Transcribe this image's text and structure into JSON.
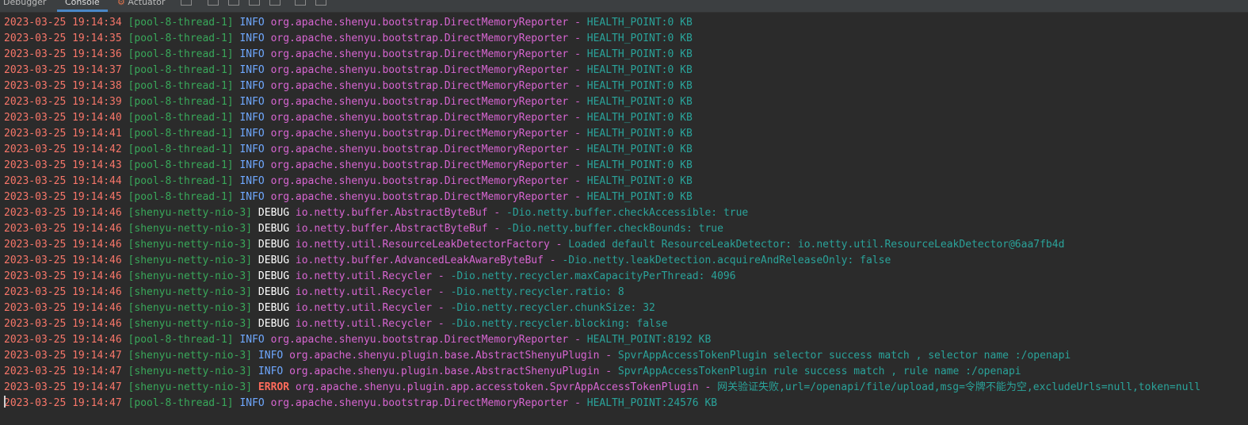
{
  "toolbar": {
    "tabs": [
      {
        "label": "Debugger",
        "active": false
      },
      {
        "label": "Console",
        "active": true
      },
      {
        "label": "Actuator",
        "active": false,
        "icon": "actuator-icon"
      }
    ]
  },
  "console": {
    "lines": [
      {
        "timestamp": "2023-03-25 19:14:34",
        "thread": "[pool-8-thread-1]",
        "level": "INFO",
        "logger": "org.apache.shenyu.bootstrap.DirectMemoryReporter",
        "message": "HEALTH_POINT:0 KB"
      },
      {
        "timestamp": "2023-03-25 19:14:35",
        "thread": "[pool-8-thread-1]",
        "level": "INFO",
        "logger": "org.apache.shenyu.bootstrap.DirectMemoryReporter",
        "message": "HEALTH_POINT:0 KB"
      },
      {
        "timestamp": "2023-03-25 19:14:36",
        "thread": "[pool-8-thread-1]",
        "level": "INFO",
        "logger": "org.apache.shenyu.bootstrap.DirectMemoryReporter",
        "message": "HEALTH_POINT:0 KB"
      },
      {
        "timestamp": "2023-03-25 19:14:37",
        "thread": "[pool-8-thread-1]",
        "level": "INFO",
        "logger": "org.apache.shenyu.bootstrap.DirectMemoryReporter",
        "message": "HEALTH_POINT:0 KB"
      },
      {
        "timestamp": "2023-03-25 19:14:38",
        "thread": "[pool-8-thread-1]",
        "level": "INFO",
        "logger": "org.apache.shenyu.bootstrap.DirectMemoryReporter",
        "message": "HEALTH_POINT:0 KB"
      },
      {
        "timestamp": "2023-03-25 19:14:39",
        "thread": "[pool-8-thread-1]",
        "level": "INFO",
        "logger": "org.apache.shenyu.bootstrap.DirectMemoryReporter",
        "message": "HEALTH_POINT:0 KB"
      },
      {
        "timestamp": "2023-03-25 19:14:40",
        "thread": "[pool-8-thread-1]",
        "level": "INFO",
        "logger": "org.apache.shenyu.bootstrap.DirectMemoryReporter",
        "message": "HEALTH_POINT:0 KB"
      },
      {
        "timestamp": "2023-03-25 19:14:41",
        "thread": "[pool-8-thread-1]",
        "level": "INFO",
        "logger": "org.apache.shenyu.bootstrap.DirectMemoryReporter",
        "message": "HEALTH_POINT:0 KB"
      },
      {
        "timestamp": "2023-03-25 19:14:42",
        "thread": "[pool-8-thread-1]",
        "level": "INFO",
        "logger": "org.apache.shenyu.bootstrap.DirectMemoryReporter",
        "message": "HEALTH_POINT:0 KB"
      },
      {
        "timestamp": "2023-03-25 19:14:43",
        "thread": "[pool-8-thread-1]",
        "level": "INFO",
        "logger": "org.apache.shenyu.bootstrap.DirectMemoryReporter",
        "message": "HEALTH_POINT:0 KB"
      },
      {
        "timestamp": "2023-03-25 19:14:44",
        "thread": "[pool-8-thread-1]",
        "level": "INFO",
        "logger": "org.apache.shenyu.bootstrap.DirectMemoryReporter",
        "message": "HEALTH_POINT:0 KB"
      },
      {
        "timestamp": "2023-03-25 19:14:45",
        "thread": "[pool-8-thread-1]",
        "level": "INFO",
        "logger": "org.apache.shenyu.bootstrap.DirectMemoryReporter",
        "message": "HEALTH_POINT:0 KB"
      },
      {
        "timestamp": "2023-03-25 19:14:46",
        "thread": "[shenyu-netty-nio-3]",
        "level": "DEBUG",
        "logger": "io.netty.buffer.AbstractByteBuf",
        "message": "-Dio.netty.buffer.checkAccessible: true"
      },
      {
        "timestamp": "2023-03-25 19:14:46",
        "thread": "[shenyu-netty-nio-3]",
        "level": "DEBUG",
        "logger": "io.netty.buffer.AbstractByteBuf",
        "message": "-Dio.netty.buffer.checkBounds: true"
      },
      {
        "timestamp": "2023-03-25 19:14:46",
        "thread": "[shenyu-netty-nio-3]",
        "level": "DEBUG",
        "logger": "io.netty.util.ResourceLeakDetectorFactory",
        "message": "Loaded default ResourceLeakDetector: io.netty.util.ResourceLeakDetector@6aa7fb4d"
      },
      {
        "timestamp": "2023-03-25 19:14:46",
        "thread": "[shenyu-netty-nio-3]",
        "level": "DEBUG",
        "logger": "io.netty.buffer.AdvancedLeakAwareByteBuf",
        "message": "-Dio.netty.leakDetection.acquireAndReleaseOnly: false"
      },
      {
        "timestamp": "2023-03-25 19:14:46",
        "thread": "[shenyu-netty-nio-3]",
        "level": "DEBUG",
        "logger": "io.netty.util.Recycler",
        "message": "-Dio.netty.recycler.maxCapacityPerThread: 4096"
      },
      {
        "timestamp": "2023-03-25 19:14:46",
        "thread": "[shenyu-netty-nio-3]",
        "level": "DEBUG",
        "logger": "io.netty.util.Recycler",
        "message": "-Dio.netty.recycler.ratio: 8"
      },
      {
        "timestamp": "2023-03-25 19:14:46",
        "thread": "[shenyu-netty-nio-3]",
        "level": "DEBUG",
        "logger": "io.netty.util.Recycler",
        "message": "-Dio.netty.recycler.chunkSize: 32"
      },
      {
        "timestamp": "2023-03-25 19:14:46",
        "thread": "[shenyu-netty-nio-3]",
        "level": "DEBUG",
        "logger": "io.netty.util.Recycler",
        "message": "-Dio.netty.recycler.blocking: false"
      },
      {
        "timestamp": "2023-03-25 19:14:46",
        "thread": "[pool-8-thread-1]",
        "level": "INFO",
        "logger": "org.apache.shenyu.bootstrap.DirectMemoryReporter",
        "message": "HEALTH_POINT:8192 KB"
      },
      {
        "timestamp": "2023-03-25 19:14:47",
        "thread": "[shenyu-netty-nio-3]",
        "level": "INFO",
        "logger": "org.apache.shenyu.plugin.base.AbstractShenyuPlugin",
        "message": "SpvrAppAccessTokenPlugin selector success match , selector name :/openapi"
      },
      {
        "timestamp": "2023-03-25 19:14:47",
        "thread": "[shenyu-netty-nio-3]",
        "level": "INFO",
        "logger": "org.apache.shenyu.plugin.base.AbstractShenyuPlugin",
        "message": "SpvrAppAccessTokenPlugin rule success match , rule name :/openapi"
      },
      {
        "timestamp": "2023-03-25 19:14:47",
        "thread": "[shenyu-netty-nio-3]",
        "level": "ERROR",
        "logger": "org.apache.shenyu.plugin.app.accesstoken.SpvrAppAccessTokenPlugin",
        "message": "网关验证失败,url=/openapi/file/upload,msg=令牌不能为空,excludeUrls=null,token=null"
      },
      {
        "timestamp": "2023-03-25 19:14:47",
        "thread": "[pool-8-thread-1]",
        "level": "INFO",
        "logger": "org.apache.shenyu.bootstrap.DirectMemoryReporter",
        "message": "HEALTH_POINT:24576 KB"
      }
    ]
  }
}
